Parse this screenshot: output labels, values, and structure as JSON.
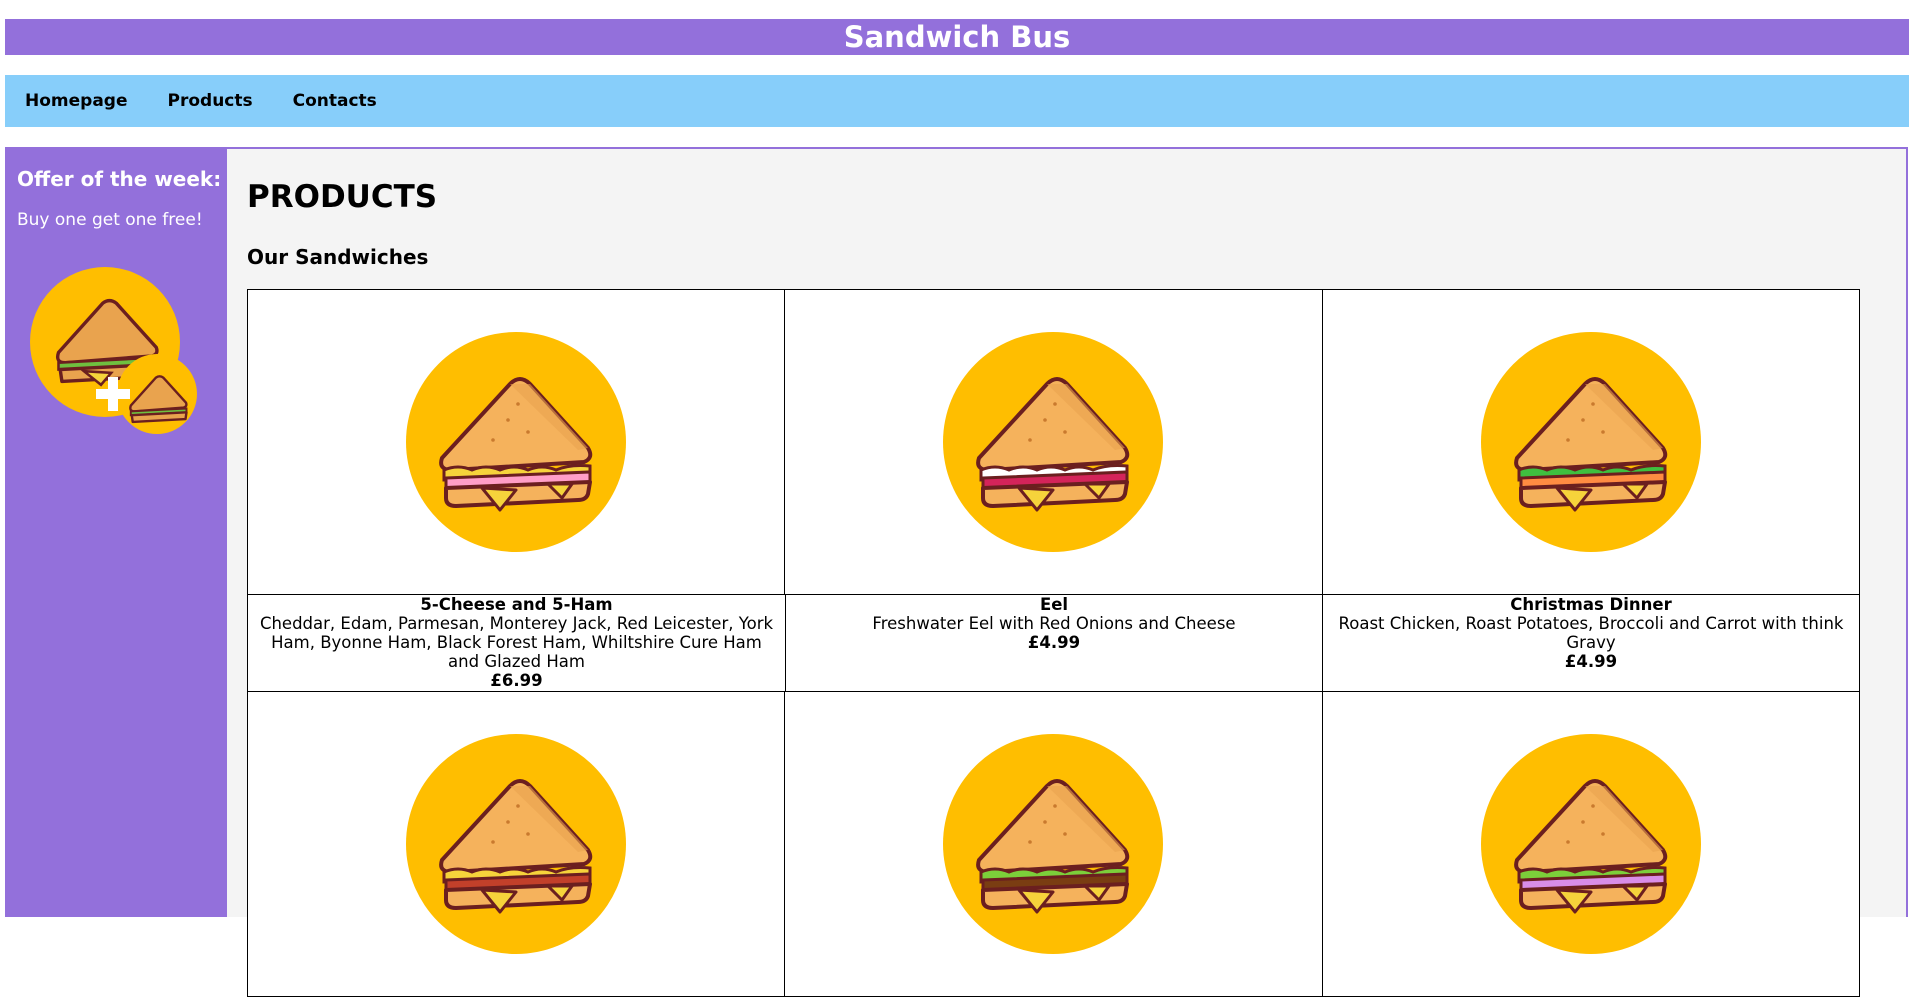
{
  "header": {
    "title": "Sandwich Bus"
  },
  "nav": {
    "items": [
      "Homepage",
      "Products",
      "Contacts"
    ]
  },
  "sidebar": {
    "offer_title": "Offer of the week:",
    "offer_text": "Buy one get one free!",
    "offer_image": "bogo-sandwich-icon"
  },
  "main": {
    "heading": "PRODUCTS",
    "subheading": "Our Sandwiches",
    "products": [
      {
        "name": "5-Cheese and 5-Ham",
        "description": "Cheddar, Edam, Parmesan, Monterey Jack, Red Leicester, York Ham, Byonne Ham, Black Forest Ham, Whiltshire Cure Ham and Glazed Ham",
        "price": "£6.99",
        "filling": "#ff9ec7",
        "greens": "#f6d33b"
      },
      {
        "name": "Eel",
        "description": "Freshwater Eel with Red Onions and Cheese",
        "price": "£4.99",
        "filling": "#d4245a",
        "greens": "#ffffff"
      },
      {
        "name": "Christmas Dinner",
        "description": "Roast Chicken, Roast Potatoes, Broccoli and Carrot with think Gravy",
        "price": "£4.99",
        "filling": "#ff8c42",
        "greens": "#3fbf3f"
      },
      {
        "filling": "#c2402a",
        "greens": "#f6d33b"
      },
      {
        "filling": "#7a3d12",
        "greens": "#7ccf3a"
      },
      {
        "filling": "#d98de8",
        "greens": "#7ccf3a"
      }
    ]
  },
  "colors": {
    "title_bar": "#9370DB",
    "nav_bar": "#87CEFA",
    "sidebar": "#9370DB",
    "content_bg": "#f4f4f4",
    "icon_circle": "#FFBE00"
  }
}
